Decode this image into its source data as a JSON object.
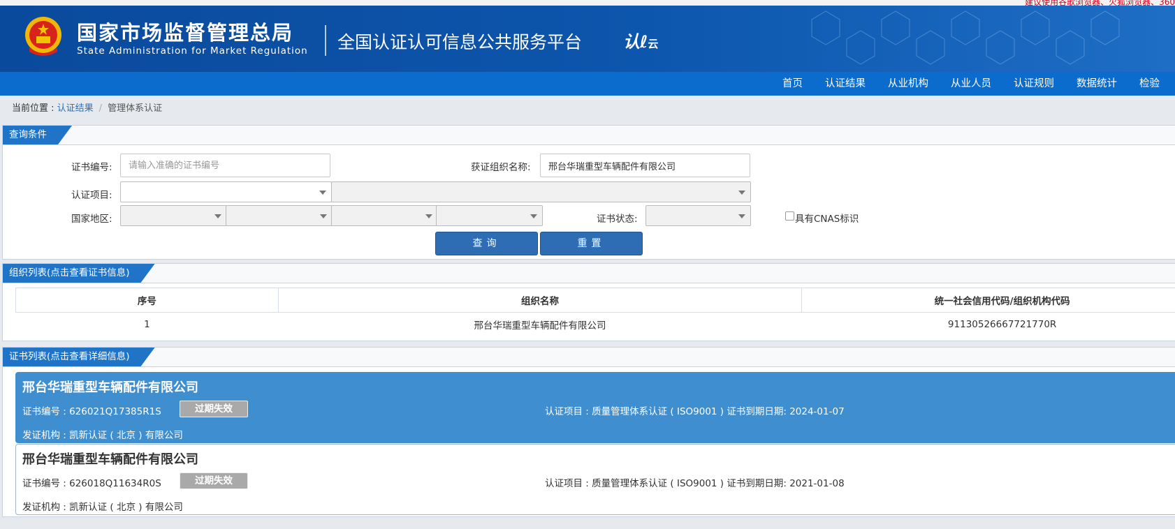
{
  "top_notice": "建议使用谷歌浏览器、火狐浏览器、360",
  "header": {
    "title_cn": "国家市场监督管理总局",
    "title_en": "State Administration  for  Market Regulation",
    "platform": "全国认证认可信息公共服务平台",
    "logo_text": "认",
    "logo_sub": "云"
  },
  "nav": [
    "首页",
    "认证结果",
    "从业机构",
    "从业人员",
    "认证规则",
    "数据统计",
    "检验"
  ],
  "breadcrumb": {
    "prefix": "当前位置 : ",
    "link": "认证结果",
    "current": "管理体系认证"
  },
  "query": {
    "tab": "查询条件",
    "cert_no_label": "证书编号:",
    "cert_no_placeholder": "请输入准确的证书编号",
    "org_label": "获证组织名称:",
    "org_value": "邢台华瑞重型车辆配件有限公司",
    "project_label": "认证项目:",
    "region_label": "国家地区:",
    "status_label": "证书状态:",
    "cnas_label": "具有CNAS标识",
    "query_btn": "查询",
    "reset_btn": "重置"
  },
  "org_list": {
    "tab": "组织列表(点击查看证书信息)",
    "columns": [
      "序号",
      "组织名称",
      "统一社会信用代码/组织机构代码"
    ],
    "rows": [
      [
        "1",
        "邢台华瑞重型车辆配件有限公司",
        "91130526667721770R"
      ]
    ]
  },
  "cert_list": {
    "tab": "证书列表(点击查看详细信息)",
    "items": [
      {
        "org": "邢台华瑞重型车辆配件有限公司",
        "cert_no": "证书编号 : 626021Q17385R1S",
        "status": "过期失效",
        "project": "认证项目 : 质量管理体系认证 ( ISO9001 )    证书到期日期: 2024-01-07",
        "issuer": "发证机构 : 凯新认证 ( 北京 ) 有限公司"
      },
      {
        "org": "邢台华瑞重型车辆配件有限公司",
        "cert_no": "证书编号 : 626018Q11634R0S",
        "status": "过期失效",
        "project": "认证项目 : 质量管理体系认证 ( ISO9001 )    证书到期日期: 2021-01-08",
        "issuer": "发证机构 : 凯新认证 ( 北京 ) 有限公司"
      }
    ]
  }
}
